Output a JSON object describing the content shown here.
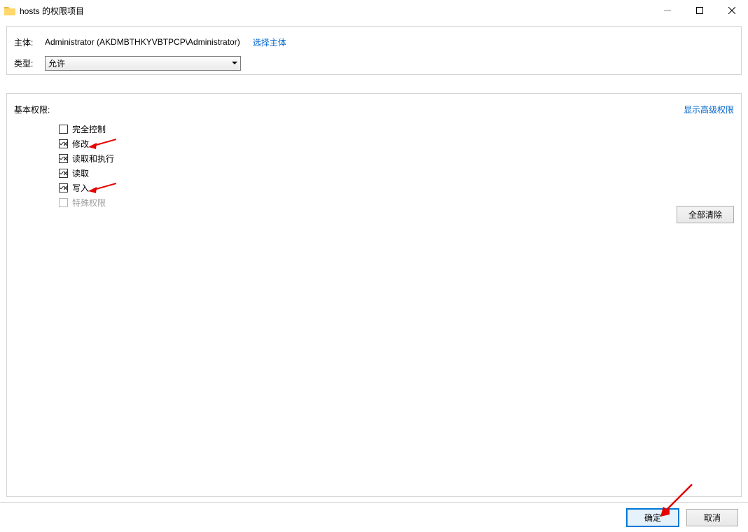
{
  "window": {
    "title": "hosts 的权限项目"
  },
  "principal": {
    "label": "主体:",
    "value": "Administrator (AKDMBTHKYVBTPCP\\Administrator)",
    "select_link": "选择主体"
  },
  "type": {
    "label": "类型:",
    "selected": "允许"
  },
  "permissions": {
    "title": "基本权限:",
    "advanced_link": "显示高级权限",
    "items": [
      {
        "label": "完全控制",
        "checked": false,
        "disabled": false
      },
      {
        "label": "修改",
        "checked": true,
        "disabled": false
      },
      {
        "label": "读取和执行",
        "checked": true,
        "disabled": false
      },
      {
        "label": "读取",
        "checked": true,
        "disabled": false
      },
      {
        "label": "写入",
        "checked": true,
        "disabled": false
      },
      {
        "label": "特殊权限",
        "checked": false,
        "disabled": true
      }
    ],
    "clear_all": "全部清除"
  },
  "buttons": {
    "ok": "确定",
    "cancel": "取消"
  }
}
